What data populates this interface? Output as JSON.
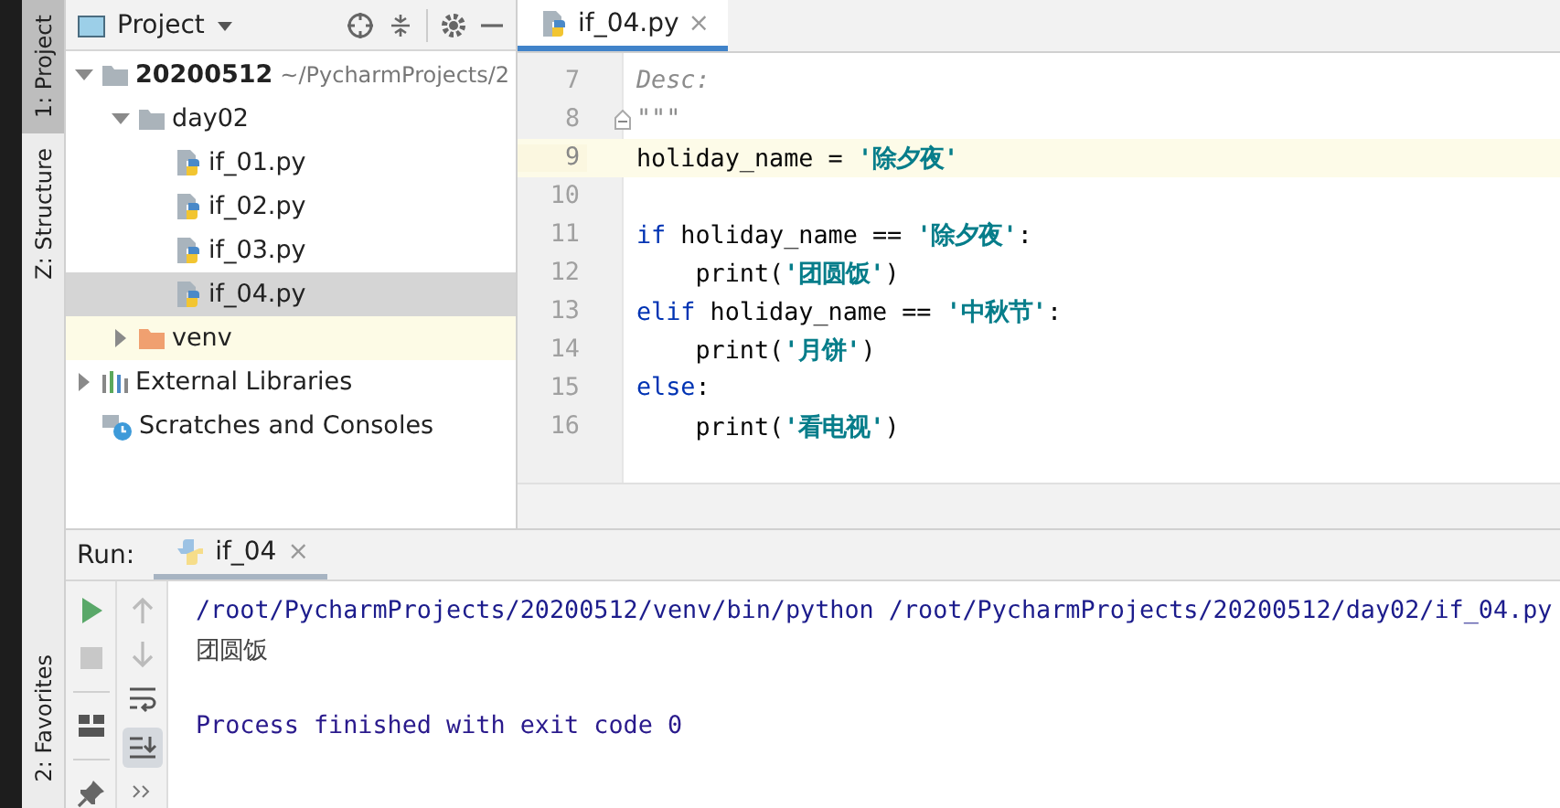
{
  "side_strip": {
    "top": [
      {
        "label": "1: Project",
        "selected": true
      },
      {
        "label": "Z: Structure",
        "selected": false
      }
    ],
    "bottom": [
      {
        "label": "2: Favorites",
        "selected": false
      }
    ]
  },
  "project_panel": {
    "title": "Project",
    "tree": [
      {
        "kind": "folder",
        "name": "20200512",
        "hint": "~/PycharmProjects/2",
        "bold": true,
        "expanded": true,
        "selected": false,
        "children": [
          {
            "kind": "folder",
            "name": "day02",
            "expanded": true,
            "selected": false,
            "children": [
              {
                "kind": "python",
                "name": "if_01.py",
                "selected": false
              },
              {
                "kind": "python",
                "name": "if_02.py",
                "selected": false
              },
              {
                "kind": "python",
                "name": "if_03.py",
                "selected": false
              },
              {
                "kind": "python",
                "name": "if_04.py",
                "selected": true
              }
            ]
          },
          {
            "kind": "excluded",
            "name": "venv",
            "expanded": false,
            "selected": false
          }
        ]
      },
      {
        "kind": "libraries",
        "name": "External Libraries",
        "expanded": false,
        "selected": false
      },
      {
        "kind": "scratches",
        "name": "Scratches and Consoles",
        "selected": false
      }
    ]
  },
  "editor": {
    "tabs": [
      {
        "label": "if_04.py",
        "close": "×",
        "selected": true
      }
    ],
    "lines": [
      {
        "number": "7",
        "current": false,
        "tokens": [
          {
            "kind": "doc",
            "text": "Desc:"
          }
        ]
      },
      {
        "number": "8",
        "current": false,
        "fold": true,
        "tokens": [
          {
            "kind": "doc",
            "text": "\"\"\""
          }
        ]
      },
      {
        "number": "9",
        "current": true,
        "tokens": [
          {
            "kind": "plain",
            "text": "holiday_name = "
          },
          {
            "kind": "string",
            "text": "'除夕夜'"
          }
        ]
      },
      {
        "number": "10",
        "current": false
      },
      {
        "number": "11",
        "current": false,
        "tokens": [
          {
            "kind": "keyword",
            "text": "if"
          },
          {
            "kind": "plain",
            "text": " holiday_name == "
          },
          {
            "kind": "string",
            "text": "'除夕夜'"
          },
          {
            "kind": "plain",
            "text": ":"
          }
        ]
      },
      {
        "number": "12",
        "current": false,
        "tokens": [
          {
            "kind": "plain",
            "text": "    print("
          },
          {
            "kind": "string",
            "text": "'团圆饭'"
          },
          {
            "kind": "plain",
            "text": ")"
          }
        ]
      },
      {
        "number": "13",
        "current": false,
        "tokens": [
          {
            "kind": "keyword",
            "text": "elif"
          },
          {
            "kind": "plain",
            "text": " holiday_name == "
          },
          {
            "kind": "string",
            "text": "'中秋节'"
          },
          {
            "kind": "plain",
            "text": ":"
          }
        ]
      },
      {
        "number": "14",
        "current": false,
        "tokens": [
          {
            "kind": "plain",
            "text": "    print("
          },
          {
            "kind": "string",
            "text": "'月饼'"
          },
          {
            "kind": "plain",
            "text": ")"
          }
        ]
      },
      {
        "number": "15",
        "current": false,
        "tokens": [
          {
            "kind": "keyword",
            "text": "else"
          },
          {
            "kind": "plain",
            "text": ":"
          }
        ]
      },
      {
        "number": "16",
        "current": false,
        "tokens": [
          {
            "kind": "plain",
            "text": "    print("
          },
          {
            "kind": "string",
            "text": "'看电视'"
          },
          {
            "kind": "plain",
            "text": ")"
          }
        ]
      }
    ]
  },
  "run_panel": {
    "label": "Run:",
    "tabs": [
      {
        "label": "if_04",
        "close": "×",
        "selected": true
      }
    ],
    "console": [
      {
        "kind": "command",
        "text": "/root/PycharmProjects/20200512/venv/bin/python /root/PycharmProjects/20200512/day02/if_04.py"
      },
      {
        "kind": "output",
        "text": "团圆饭"
      },
      {
        "kind": "blank"
      },
      {
        "kind": "system",
        "text": "Process finished with exit code 0"
      }
    ]
  }
}
